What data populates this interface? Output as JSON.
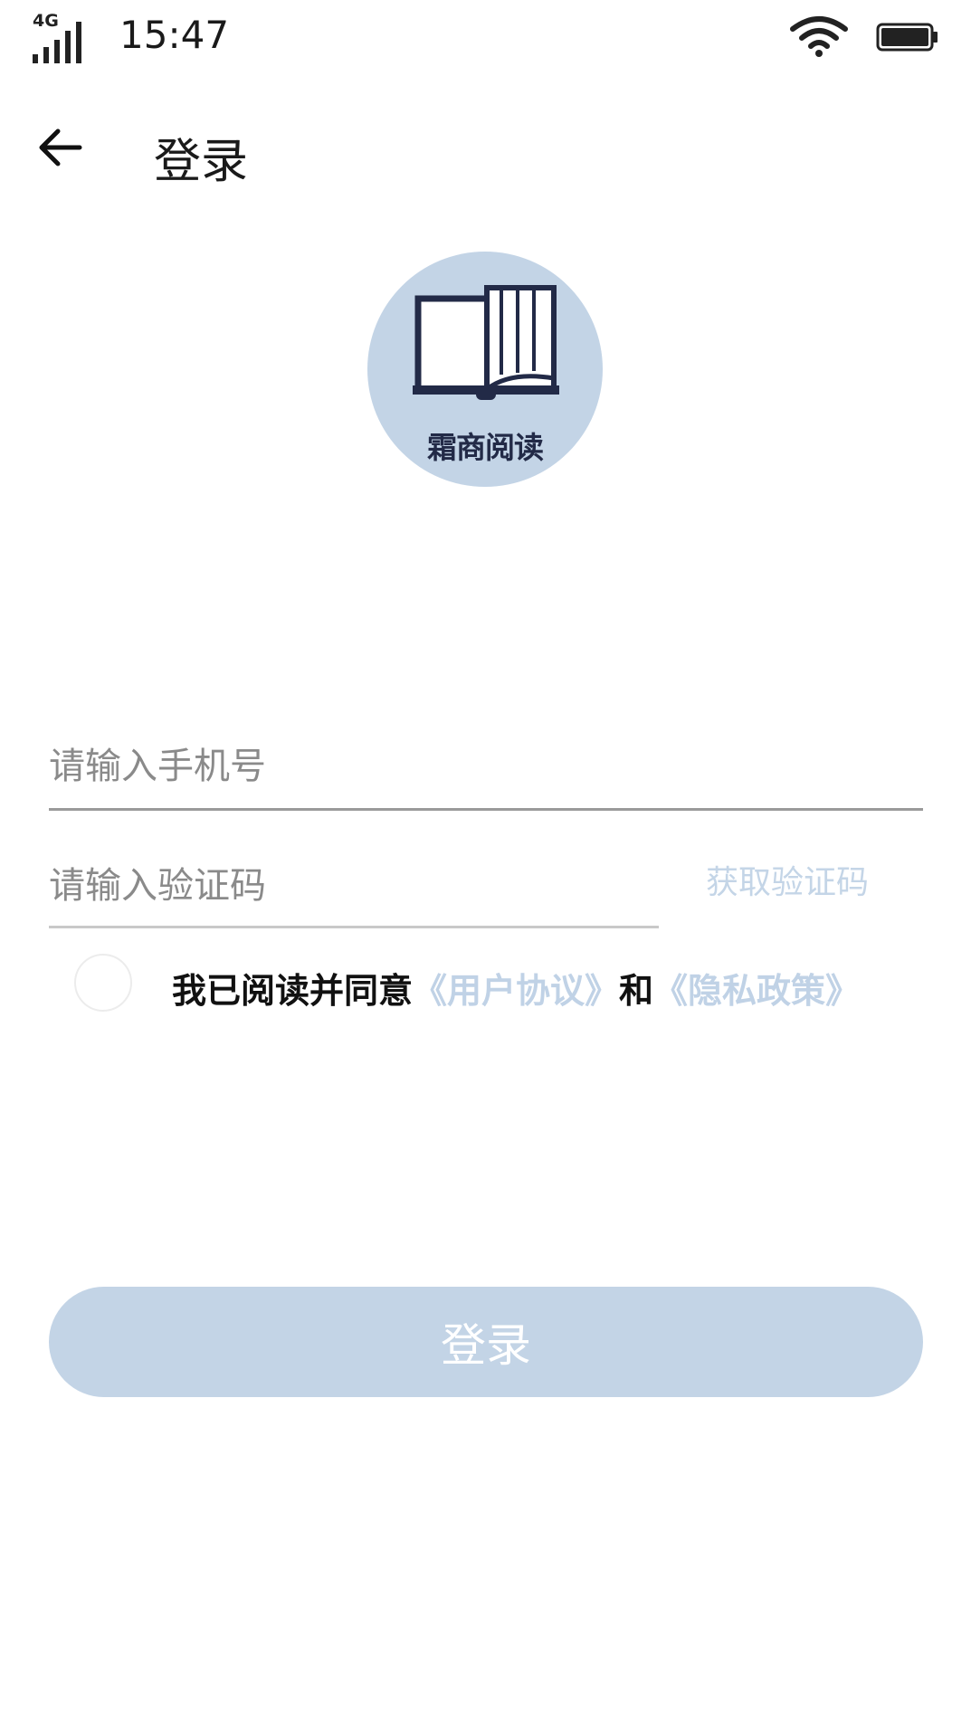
{
  "status_bar": {
    "network": "4G",
    "time": "15:47",
    "icons": [
      "signal-icon",
      "wifi-icon",
      "battery-icon"
    ]
  },
  "header": {
    "back_icon": "back-arrow-icon",
    "title": "登录"
  },
  "logo": {
    "icon": "open-book-icon",
    "text": "霜商阅读",
    "background_color": "#c3d4e6",
    "ink_color": "#222a47"
  },
  "form": {
    "phone": {
      "placeholder": "请输入手机号",
      "value": ""
    },
    "code": {
      "placeholder": "请输入验证码",
      "value": ""
    },
    "get_code_label": "获取验证码"
  },
  "agreement": {
    "checked": false,
    "prefix": "我已阅读并同意",
    "user_agreement": "《用户协议》",
    "conjunction": "和",
    "privacy_policy": "《隐私政策》",
    "link_color": "#c0d2e6"
  },
  "login_button": {
    "label": "登录",
    "color": "#c3d4e6"
  }
}
